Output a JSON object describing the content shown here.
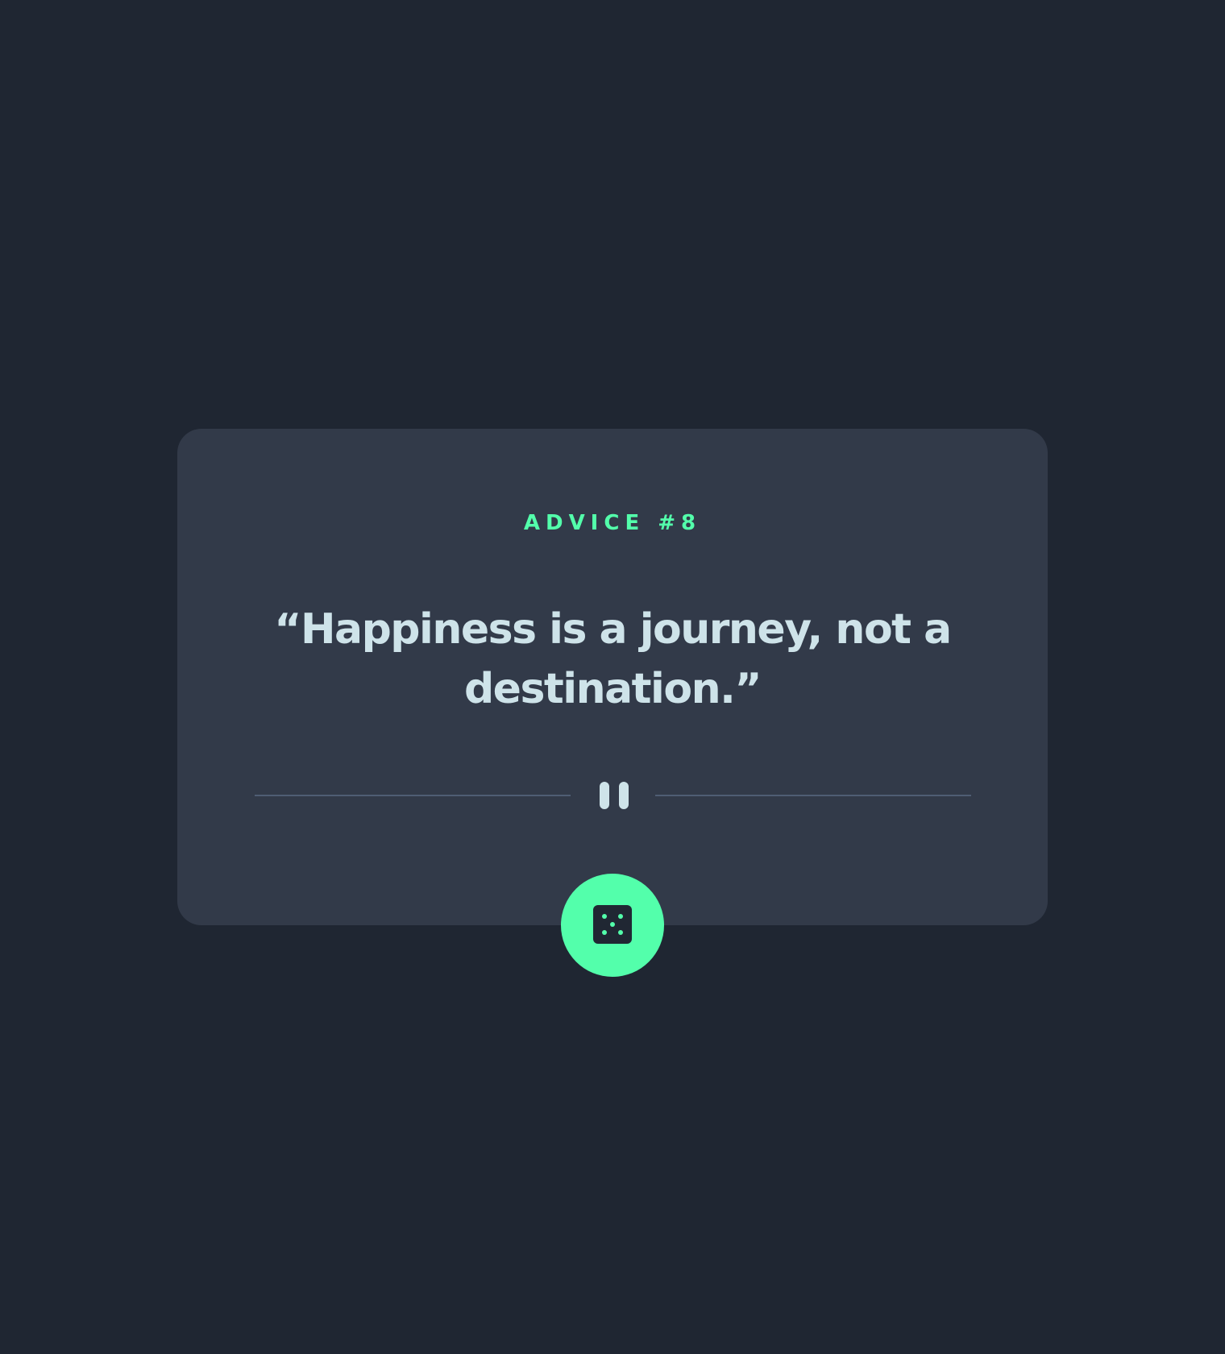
{
  "card": {
    "advice_label": "ADVICE #8",
    "quote": "“Happiness is a journey, not a destination.”"
  },
  "icons": {
    "divider": "pause-icon",
    "button": "dice-icon"
  },
  "colors": {
    "background": "#1f2632",
    "card": "#323a49",
    "accent": "#53ffab",
    "text": "#cee3e9",
    "divider": "#4f5d74"
  }
}
